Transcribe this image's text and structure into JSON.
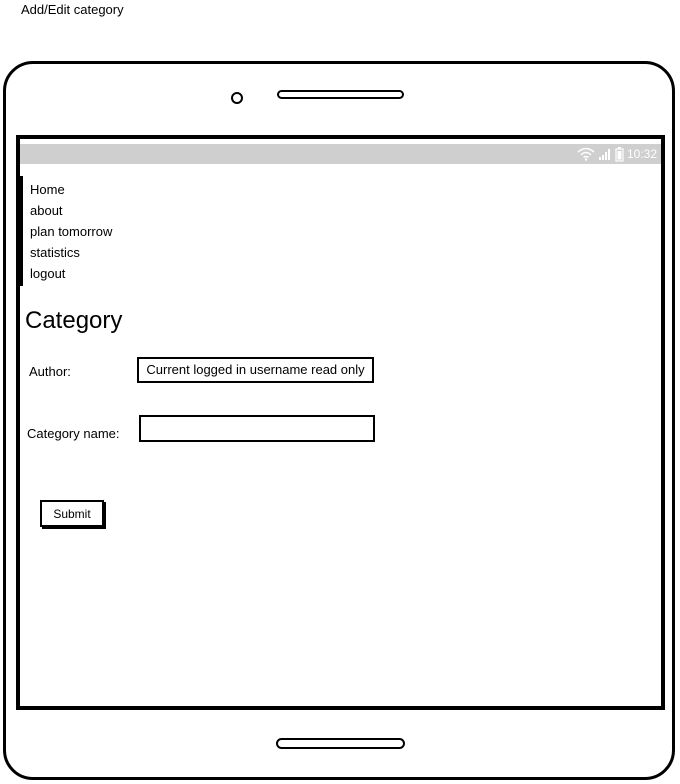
{
  "page": {
    "caption": "Add/Edit category"
  },
  "status_bar": {
    "time": "10:32",
    "icons": [
      "wifi-icon",
      "signal-icon",
      "battery-icon"
    ],
    "background": "#cfcfcf"
  },
  "nav": {
    "items": [
      {
        "label": "Home"
      },
      {
        "label": "about"
      },
      {
        "label": "plan tomorrow"
      },
      {
        "label": "statistics"
      },
      {
        "label": "logout"
      }
    ]
  },
  "form": {
    "title": "Category",
    "author_label": "Author:",
    "author_value": "Current logged in username read only",
    "category_name_label": "Category name:",
    "category_name_value": "",
    "submit_label": "Submit"
  }
}
